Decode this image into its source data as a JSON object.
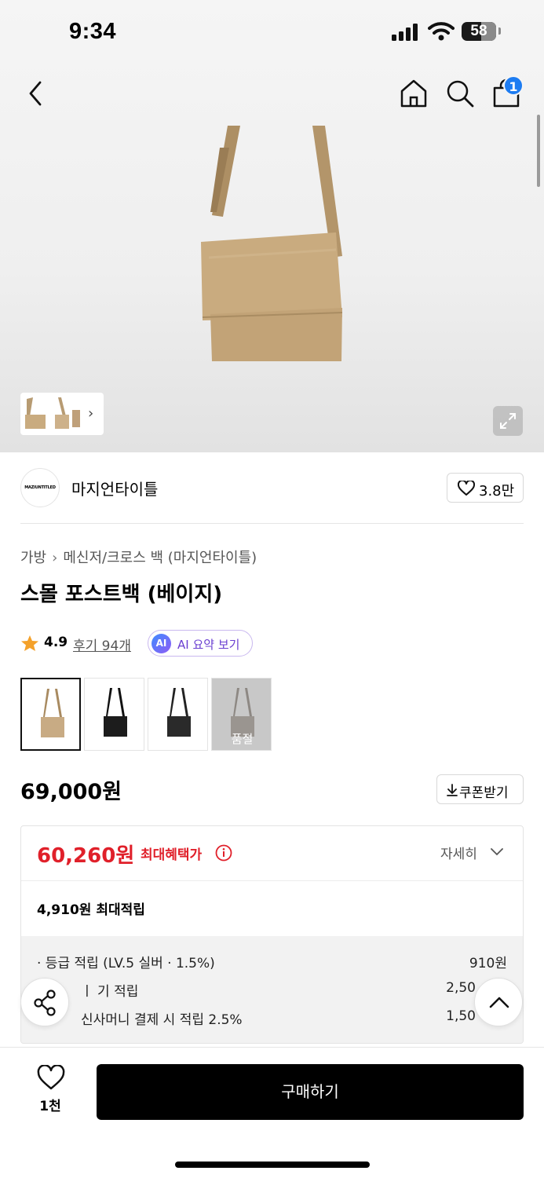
{
  "status_bar": {
    "time": "9:34",
    "battery": "58"
  },
  "nav": {
    "cart_count": "1"
  },
  "brand": {
    "name": "마지언타이틀",
    "logo_text": "MAZIUNTITLED",
    "likes": "3.8만"
  },
  "breadcrumb": [
    "가방",
    "메신저/크로스 백 (마지언타이틀)"
  ],
  "product": {
    "title": "스몰 포스트백 (베이지)",
    "rating": "4.9",
    "reviews": "후기 94개",
    "ai_badge": "AI",
    "ai_summary": "AI 요약 보기",
    "price": "69,000원",
    "coupon": "쿠폰받기"
  },
  "variants": [
    {
      "color": "#c8ab84",
      "selected": true
    },
    {
      "color": "#1c1c1c"
    },
    {
      "color": "#2a2a2a"
    },
    {
      "color": "#9a9590",
      "soldout_label": "품절"
    }
  ],
  "benefit": {
    "max_price": "60,260원",
    "max_label": "최대혜택가",
    "detail": "자세히",
    "points_total": "4,910원 최대적립",
    "rows": [
      {
        "label": "· 등급 적립 (LV.5 실버 · 1.5%)",
        "value": "910원"
      },
      {
        "label": "ㅣ 기 적립",
        "value": "2,50"
      },
      {
        "label": "신사머니 결제 시 적립 2.5%",
        "value": "1,50"
      }
    ]
  },
  "bottom": {
    "wish_count": "1천",
    "buy": "구매하기"
  },
  "colors": {
    "accent_red": "#e0202a",
    "badge_blue": "#1d7cf2",
    "ai_purple": "#6a3fd1"
  }
}
